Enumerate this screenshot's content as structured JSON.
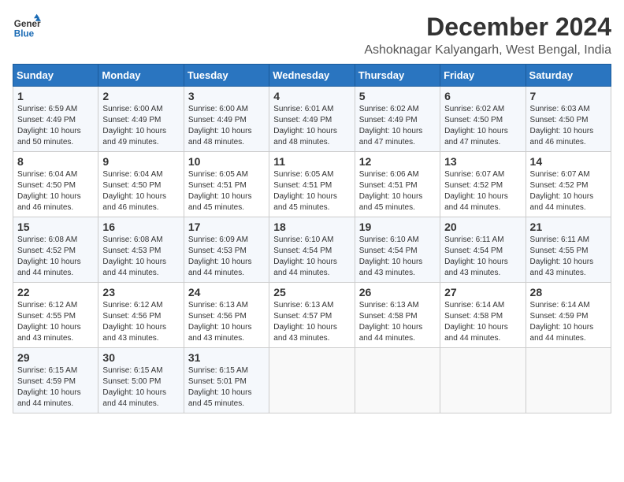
{
  "logo": {
    "line1": "General",
    "line2": "Blue"
  },
  "title": "December 2024",
  "subtitle": "Ashoknagar Kalyangarh, West Bengal, India",
  "weekdays": [
    "Sunday",
    "Monday",
    "Tuesday",
    "Wednesday",
    "Thursday",
    "Friday",
    "Saturday"
  ],
  "weeks": [
    [
      {
        "day": 1,
        "sunrise": "6:59 AM",
        "sunset": "4:49 PM",
        "daylight": "10 hours and 50 minutes."
      },
      {
        "day": 2,
        "sunrise": "6:00 AM",
        "sunset": "4:49 PM",
        "daylight": "10 hours and 49 minutes."
      },
      {
        "day": 3,
        "sunrise": "6:00 AM",
        "sunset": "4:49 PM",
        "daylight": "10 hours and 48 minutes."
      },
      {
        "day": 4,
        "sunrise": "6:01 AM",
        "sunset": "4:49 PM",
        "daylight": "10 hours and 48 minutes."
      },
      {
        "day": 5,
        "sunrise": "6:02 AM",
        "sunset": "4:49 PM",
        "daylight": "10 hours and 47 minutes."
      },
      {
        "day": 6,
        "sunrise": "6:02 AM",
        "sunset": "4:50 PM",
        "daylight": "10 hours and 47 minutes."
      },
      {
        "day": 7,
        "sunrise": "6:03 AM",
        "sunset": "4:50 PM",
        "daylight": "10 hours and 46 minutes."
      }
    ],
    [
      {
        "day": 8,
        "sunrise": "6:04 AM",
        "sunset": "4:50 PM",
        "daylight": "10 hours and 46 minutes."
      },
      {
        "day": 9,
        "sunrise": "6:04 AM",
        "sunset": "4:50 PM",
        "daylight": "10 hours and 46 minutes."
      },
      {
        "day": 10,
        "sunrise": "6:05 AM",
        "sunset": "4:51 PM",
        "daylight": "10 hours and 45 minutes."
      },
      {
        "day": 11,
        "sunrise": "6:05 AM",
        "sunset": "4:51 PM",
        "daylight": "10 hours and 45 minutes."
      },
      {
        "day": 12,
        "sunrise": "6:06 AM",
        "sunset": "4:51 PM",
        "daylight": "10 hours and 45 minutes."
      },
      {
        "day": 13,
        "sunrise": "6:07 AM",
        "sunset": "4:52 PM",
        "daylight": "10 hours and 44 minutes."
      },
      {
        "day": 14,
        "sunrise": "6:07 AM",
        "sunset": "4:52 PM",
        "daylight": "10 hours and 44 minutes."
      }
    ],
    [
      {
        "day": 15,
        "sunrise": "6:08 AM",
        "sunset": "4:52 PM",
        "daylight": "10 hours and 44 minutes."
      },
      {
        "day": 16,
        "sunrise": "6:08 AM",
        "sunset": "4:53 PM",
        "daylight": "10 hours and 44 minutes."
      },
      {
        "day": 17,
        "sunrise": "6:09 AM",
        "sunset": "4:53 PM",
        "daylight": "10 hours and 44 minutes."
      },
      {
        "day": 18,
        "sunrise": "6:10 AM",
        "sunset": "4:54 PM",
        "daylight": "10 hours and 44 minutes."
      },
      {
        "day": 19,
        "sunrise": "6:10 AM",
        "sunset": "4:54 PM",
        "daylight": "10 hours and 43 minutes."
      },
      {
        "day": 20,
        "sunrise": "6:11 AM",
        "sunset": "4:54 PM",
        "daylight": "10 hours and 43 minutes."
      },
      {
        "day": 21,
        "sunrise": "6:11 AM",
        "sunset": "4:55 PM",
        "daylight": "10 hours and 43 minutes."
      }
    ],
    [
      {
        "day": 22,
        "sunrise": "6:12 AM",
        "sunset": "4:55 PM",
        "daylight": "10 hours and 43 minutes."
      },
      {
        "day": 23,
        "sunrise": "6:12 AM",
        "sunset": "4:56 PM",
        "daylight": "10 hours and 43 minutes."
      },
      {
        "day": 24,
        "sunrise": "6:13 AM",
        "sunset": "4:56 PM",
        "daylight": "10 hours and 43 minutes."
      },
      {
        "day": 25,
        "sunrise": "6:13 AM",
        "sunset": "4:57 PM",
        "daylight": "10 hours and 43 minutes."
      },
      {
        "day": 26,
        "sunrise": "6:13 AM",
        "sunset": "4:58 PM",
        "daylight": "10 hours and 44 minutes."
      },
      {
        "day": 27,
        "sunrise": "6:14 AM",
        "sunset": "4:58 PM",
        "daylight": "10 hours and 44 minutes."
      },
      {
        "day": 28,
        "sunrise": "6:14 AM",
        "sunset": "4:59 PM",
        "daylight": "10 hours and 44 minutes."
      }
    ],
    [
      {
        "day": 29,
        "sunrise": "6:15 AM",
        "sunset": "4:59 PM",
        "daylight": "10 hours and 44 minutes."
      },
      {
        "day": 30,
        "sunrise": "6:15 AM",
        "sunset": "5:00 PM",
        "daylight": "10 hours and 44 minutes."
      },
      {
        "day": 31,
        "sunrise": "6:15 AM",
        "sunset": "5:01 PM",
        "daylight": "10 hours and 45 minutes."
      },
      null,
      null,
      null,
      null
    ]
  ]
}
